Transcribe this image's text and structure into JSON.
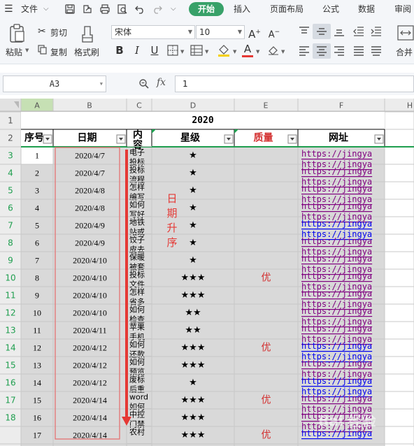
{
  "menu": {
    "file_label": "文件",
    "tabs": [
      "开始",
      "插入",
      "页面布局",
      "公式",
      "数据",
      "审阅"
    ],
    "active_tab": "开始"
  },
  "ribbon": {
    "paste_label": "粘贴",
    "cut_label": "剪切",
    "copy_label": "复制",
    "format_painter_label": "格式刷",
    "font_name": "宋体",
    "font_size": "10",
    "merge_label": "合并"
  },
  "formula_bar": {
    "name_box": "A3",
    "fx_label": "fx",
    "value": "1"
  },
  "sheet": {
    "columns": [
      "A",
      "B",
      "C",
      "D",
      "E",
      "F",
      "H"
    ],
    "row_numbers": [
      "1",
      "2",
      "3",
      "4",
      "5",
      "6",
      "7",
      "8",
      "9",
      "10",
      "11",
      "12",
      "13",
      "14",
      "15",
      "16",
      "17",
      "18"
    ],
    "title": "2020",
    "headers": [
      "序号",
      "日期",
      "内容",
      "星级",
      "质量",
      "网址"
    ],
    "rows": [
      {
        "no": "1",
        "date": "2020/4/7",
        "content": [
          "电子",
          "投标"
        ],
        "stars": "★",
        "quality": "",
        "url": "https://jingya",
        "url2": "https://jingya",
        "visited": true
      },
      {
        "no": "2",
        "date": "2020/4/7",
        "content": [
          "投标",
          "流程"
        ],
        "stars": "★",
        "quality": "",
        "url": "https://jingya",
        "url2": "https://jingya",
        "visited": true
      },
      {
        "no": "3",
        "date": "2020/4/8",
        "content": [
          "怎样",
          "编写"
        ],
        "stars": "★",
        "quality": "",
        "url": "https://jingya",
        "url2": "https://jingya",
        "visited": true
      },
      {
        "no": "4",
        "date": "2020/4/8",
        "content": [
          "如何",
          "写好"
        ],
        "stars": "★",
        "quality": "",
        "url": "https://jingya",
        "url2": "https://jingya",
        "visited": true
      },
      {
        "no": "5",
        "date": "2020/4/9",
        "content": [
          "地铁",
          "站或"
        ],
        "stars": "★",
        "quality": "",
        "url": "https://jingya",
        "url2": "https://jingya",
        "visited": false
      },
      {
        "no": "6",
        "date": "2020/4/9",
        "content": [
          "饺子",
          "皮去"
        ],
        "stars": "★",
        "quality": "",
        "url": "https://jingya",
        "url2": "https://jingya",
        "visited": true
      },
      {
        "no": "7",
        "date": "2020/4/10",
        "content": [
          "保暖",
          "被套"
        ],
        "stars": "★",
        "quality": "",
        "url": "https://jingya",
        "url2": "https://jingya",
        "visited": true
      },
      {
        "no": "8",
        "date": "2020/4/10",
        "content": [
          "投标",
          "文件"
        ],
        "stars": "★★★",
        "quality": "优",
        "url": "https://jingya",
        "url2": "https://jingya",
        "visited": true
      },
      {
        "no": "9",
        "date": "2020/4/10",
        "content": [
          "怎样",
          "省多"
        ],
        "stars": "★★★",
        "quality": "",
        "url": "https://jingya",
        "url2": "https://jingya",
        "visited": true
      },
      {
        "no": "10",
        "date": "2020/4/10",
        "content": [
          "如何",
          "检查"
        ],
        "stars": "★★",
        "quality": "",
        "url": "https://jingya",
        "url2": "https://jingya",
        "visited": true
      },
      {
        "no": "11",
        "date": "2020/4/11",
        "content": [
          "苹果",
          "手机"
        ],
        "stars": "★★",
        "quality": "",
        "url": "https://jingya",
        "url2": "https://jingya",
        "visited": true
      },
      {
        "no": "12",
        "date": "2020/4/12",
        "content": [
          "如何",
          "还款"
        ],
        "stars": "★★★",
        "quality": "优",
        "url": "https://jingya",
        "url2": "https://jingya",
        "visited": false
      },
      {
        "no": "13",
        "date": "2020/4/12",
        "content": [
          "如何",
          "预览"
        ],
        "stars": "★★★",
        "quality": "",
        "url": "https://jingya",
        "url2": "https://jingya",
        "visited": true
      },
      {
        "no": "14",
        "date": "2020/4/12",
        "content": [
          "废标",
          "后重"
        ],
        "stars": "★",
        "quality": "",
        "url": "https://jingya",
        "url2": "https://jingya",
        "visited": false
      },
      {
        "no": "15",
        "date": "2020/4/14",
        "content": [
          "word",
          "如何"
        ],
        "stars": "★★★",
        "quality": "优",
        "url": "https://jingya",
        "url2": "https://jingya",
        "visited": true
      },
      {
        "no": "16",
        "date": "2020/4/14",
        "content": [
          "中控",
          "门禁"
        ],
        "stars": "★★★",
        "quality": "",
        "url": "https://jingya",
        "url2": "https://jingya",
        "visited": true
      },
      {
        "no": "17",
        "date": "2020/4/14",
        "content": [
          "农村",
          ""
        ],
        "stars": "★★★",
        "quality": "优",
        "url": "https://jingya",
        "url2": "",
        "visited": false
      }
    ],
    "annotation": [
      "日",
      "期",
      "升",
      "序"
    ],
    "watermark": "Bai 经验"
  },
  "colors": {
    "accent_green": "#38a169",
    "header_green": "#1e9e4e",
    "annotation_red": "#e53935",
    "quality_red": "#d32f2f",
    "link_purple": "#800080",
    "link_blue": "#0000ee",
    "cell_gray": "#d9d9d9",
    "selected_header": "#c6e0b4"
  }
}
